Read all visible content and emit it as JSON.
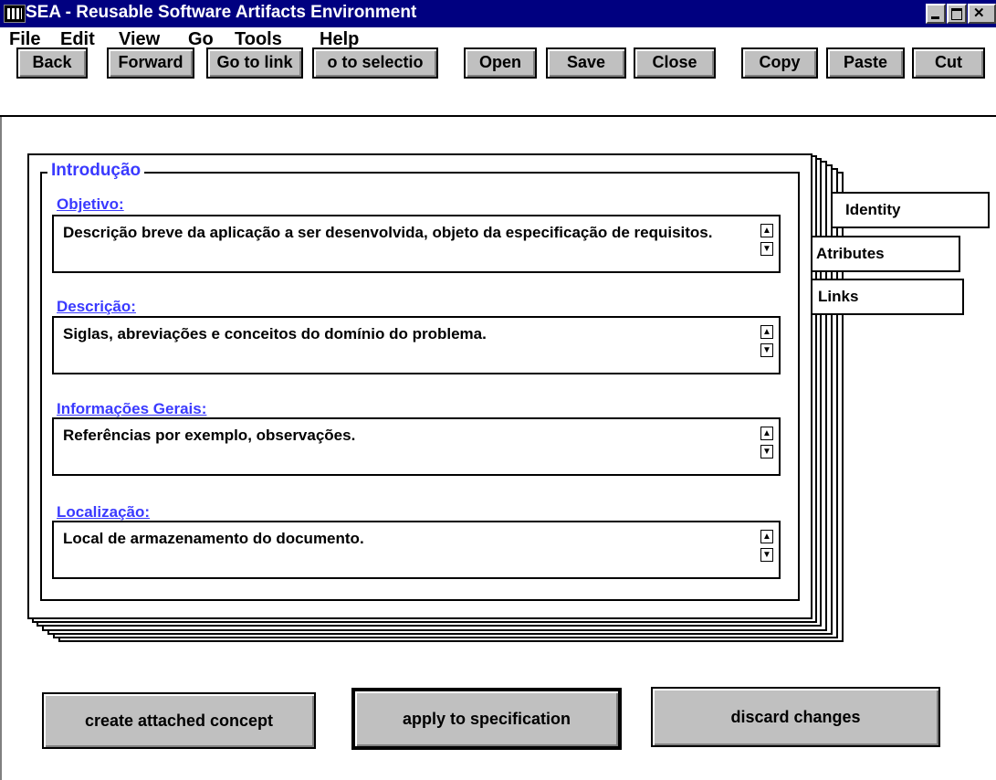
{
  "window": {
    "title": "SEA - Reusable Software Artifacts Environment"
  },
  "menu": [
    "File",
    "Edit",
    "View",
    "Go",
    "Tools",
    "Help"
  ],
  "toolbar": [
    "Back",
    "Forward",
    "Go to link",
    "o to selectio",
    "Open",
    "Save",
    "Close",
    "Copy",
    "Paste",
    "Cut"
  ],
  "section": {
    "title": "Introdução",
    "fields": [
      {
        "label": "Objetivo:",
        "text": "Descrição breve da aplicação a ser desenvolvida, objeto da especificação de requisitos."
      },
      {
        "label": "Descrição:",
        "text": "Siglas, abreviações e conceitos do domínio do problema."
      },
      {
        "label": "Informações Gerais:",
        "text": "Referências por exemplo, observações."
      },
      {
        "label": "Localização:",
        "text": "Local de armazenamento do documento."
      }
    ]
  },
  "tabs": [
    "Identity",
    "Atributes",
    "Links"
  ],
  "actions": [
    "create attached concept",
    "apply to specification",
    "discard changes"
  ]
}
